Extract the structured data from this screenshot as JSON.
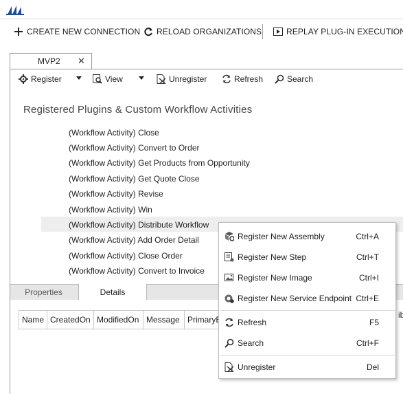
{
  "topbar": {
    "create_connection": "CREATE NEW CONNECTION",
    "reload_organizations": "RELOAD ORGANIZATIONS",
    "replay_plugin": "REPLAY PLUG-IN EXECUTION"
  },
  "connection_tab": {
    "label": "MVP2",
    "close": "✕"
  },
  "toolbar": {
    "register": "Register",
    "view": "View",
    "unregister": "Unregister",
    "refresh": "Refresh",
    "search": "Search"
  },
  "heading": "Registered Plugins & Custom Workflow Activities",
  "plugins": [
    "(Workflow Activity) Close",
    "(Workflow Activity) Convert to Order",
    "(Workflow Activity) Get Products from  Opportunity",
    "(Workflow Activity) Get Quote Close",
    "(Workflow Activity) Revise",
    "(Workflow Activity) Win",
    "(Workflow Activity) Distribute Workflow",
    "(Workflow Activity) Add Order Detail",
    "(Workflow Activity) Close Order",
    "(Workflow Activity) Convert to Invoice"
  ],
  "selected_plugin_index": 6,
  "bottom_tabs": {
    "properties": "Properties",
    "details": "Details"
  },
  "columns": [
    "Name",
    "CreatedOn",
    "ModifiedOn",
    "Message",
    "PrimaryEntity"
  ],
  "column_clipped_right": "ibu",
  "context_menu": {
    "register_assembly": {
      "label": "Register New Assembly",
      "shortcut": "Ctrl+A"
    },
    "register_step": {
      "label": "Register New Step",
      "shortcut": "Ctrl+T"
    },
    "register_image": {
      "label": "Register New Image",
      "shortcut": "Ctrl+I"
    },
    "register_endpoint": {
      "label": "Register New Service Endpoint",
      "shortcut": "Ctrl+E"
    },
    "refresh": {
      "label": "Refresh",
      "shortcut": "F5"
    },
    "search": {
      "label": "Search",
      "shortcut": "Ctrl+F"
    },
    "unregister": {
      "label": "Unregister",
      "shortcut": "Del"
    }
  },
  "icons": {
    "logo": "dynamics-logo-icon",
    "plus": "plus-icon",
    "reload": "reload-icon",
    "replay": "play-icon",
    "register": "gear-icon",
    "view": "view-icon",
    "unregister": "unregister-icon",
    "refresh": "refresh-icon",
    "search": "search-icon"
  },
  "colors": {
    "accent": "#1f4e8c",
    "selected_row": "#eeeeee"
  }
}
